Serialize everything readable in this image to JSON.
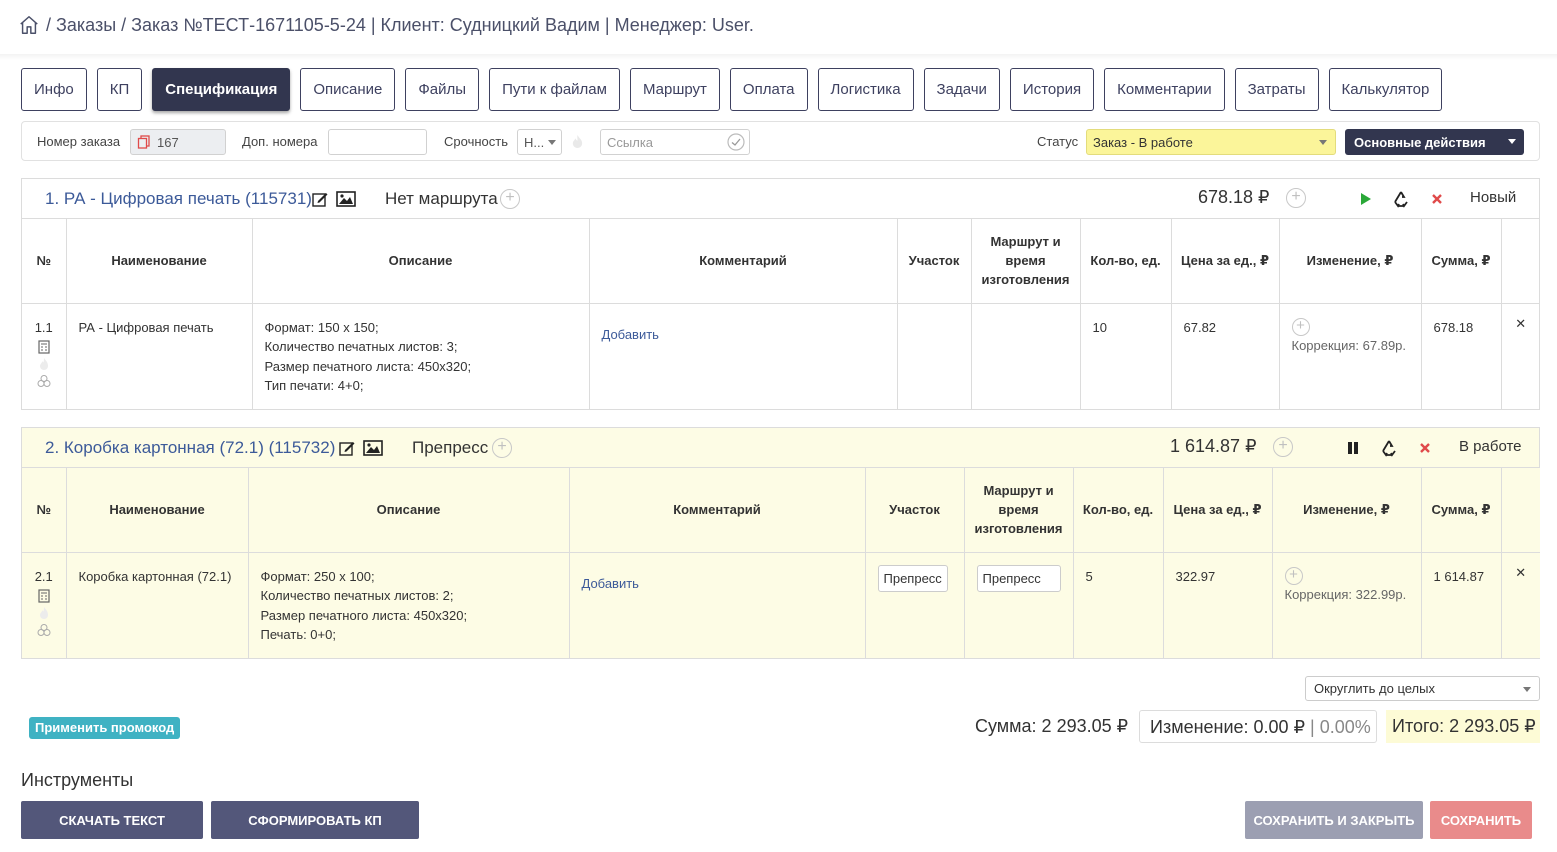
{
  "breadcrumb": {
    "text": " / Заказы / Заказ №ТЕСТ-1671105-5-24 | Клиент: Судницкий Вадим | Менеджер: User."
  },
  "tabs": [
    {
      "label": "Инфо"
    },
    {
      "label": "КП"
    },
    {
      "label": "Спецификация",
      "active": true
    },
    {
      "label": "Описание"
    },
    {
      "label": "Файлы"
    },
    {
      "label": "Пути к файлам"
    },
    {
      "label": "Маршрут"
    },
    {
      "label": "Оплата"
    },
    {
      "label": "Логистика"
    },
    {
      "label": "Задачи"
    },
    {
      "label": "История"
    },
    {
      "label": "Комментарии"
    },
    {
      "label": "Затраты"
    },
    {
      "label": "Калькулятор"
    }
  ],
  "filters": {
    "order_number_label": "Номер заказа",
    "order_number_value": "167",
    "extra_numbers_label": "Доп. номера",
    "extra_numbers_value": "",
    "urgency_label": "Срочность",
    "urgency_value": "Н...",
    "link_placeholder": "Ссылка",
    "status_label": "Статус",
    "status_value": "Заказ - В работе",
    "main_actions_label": "Основные действия"
  },
  "columns": {
    "num": "№",
    "name": "Наименование",
    "description": "Описание",
    "comment": "Комментарий",
    "section": "Участок",
    "route": "Маршрут и время изготовления",
    "qty": "Кол-во, ед.",
    "price": "Цена за ед., ₽",
    "change": "Изменение, ₽",
    "sum": "Сумма, ₽"
  },
  "products": [
    {
      "title": "1. РА - Цифровая печать (115731)",
      "route": "Нет маршрута",
      "sum": "678.18 ₽",
      "state": "Новый",
      "row": {
        "num": "1.1",
        "name": "РА - Цифровая печать",
        "desc": [
          "Формат: 150 х 150;",
          "Количество печатных листов: 3;",
          "Размер печатного листа: 450х320;",
          "Тип печати: 4+0;"
        ],
        "comment_link": "Добавить",
        "section": "",
        "route": "",
        "qty": "10",
        "price": "67.82",
        "correction": "Коррекция: 67.89р.",
        "sum": "678.18"
      }
    },
    {
      "title": "2. Коробка картонная (72.1) (115732)",
      "route": "Препресс",
      "sum": "1 614.87 ₽",
      "state": "В работе",
      "row": {
        "num": "2.1",
        "name": "Коробка картонная (72.1)",
        "desc": [
          "Формат: 250 х 100;",
          "Количество печатных листов: 2;",
          "Размер печатного листа: 450х320;",
          "Печать: 0+0;"
        ],
        "comment_link": "Добавить",
        "section": "Препресс",
        "route": "Препресс",
        "qty": "5",
        "price": "322.97",
        "correction": "Коррекция: 322.99р.",
        "sum": "1 614.87"
      }
    }
  ],
  "rounding": "Округлить до целых",
  "promo_button": "Применить промокод",
  "totals": {
    "sum": "Сумма: 2 293.05 ₽",
    "change": "Изменение: 0.00 ₽",
    "change_pct": " | 0.00%",
    "total": "Итого: 2 293.05 ₽"
  },
  "tools_title": "Инструменты",
  "buttons": {
    "download_text": "СКАЧАТЬ ТЕКСТ",
    "make_kp": "СФОРМИРОВАТЬ КП",
    "save_close": "СОХРАНИТЬ И ЗАКРЫТЬ",
    "save": "СОХРАНИТЬ"
  },
  "colors": {
    "accent_dark": "#32364f",
    "link_blue": "#3c5a99",
    "status_yellow": "#fbf59a",
    "danger_red": "#e04a4a",
    "promo_teal": "#3fb2c3"
  }
}
